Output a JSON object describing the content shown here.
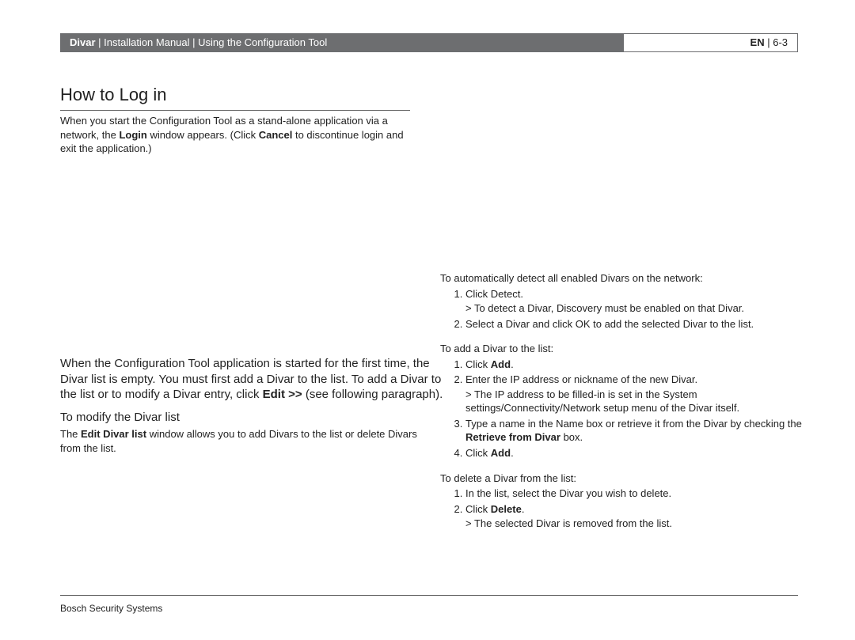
{
  "header": {
    "product": "Divar",
    "trail": " | Installation Manual | Using the Configuration Tool",
    "lang": "EN",
    "page": " | 6-3"
  },
  "heading": "How to Log in",
  "intro": {
    "p1a": "When you start the Configuration Tool as a stand-alone application via a network, the ",
    "login": "Login",
    "p1b": " window appears. (Click ",
    "cancel": "Cancel",
    "p1c": " to discontinue login and exit the application.)"
  },
  "mid": {
    "t1": "When the Configuration Tool application is started for the first time, the Divar list is empty. You must first add a Divar to the list. To add a Divar to the list or to modify a Divar entry, click ",
    "edit": "Edit >>",
    "t2": " (see following paragraph)."
  },
  "sub": {
    "heading": "To modify the Divar list",
    "body_a": "The ",
    "body_b": "Edit Divar list",
    "body_c": " window allows you to add Divars to the list or delete Divars from the list."
  },
  "right": {
    "detect": {
      "lead": "To automatically detect all enabled Divars on the network:",
      "li1": "Click Detect.",
      "li1note": "> To detect a Divar, Discovery must be enabled on that Divar.",
      "li2": "Select a Divar and click OK to add the selected Divar to the list."
    },
    "add": {
      "lead": "To add a Divar to the list:",
      "li1a": "Click ",
      "li1b": "Add",
      "li1c": ".",
      "li2": "Enter the IP address or nickname of the new Divar.",
      "li2note": "> The IP address to be filled-in is set in the System settings/Connectivity/Network setup menu of the Divar itself.",
      "li3a": "Type a name in the Name box or retrieve it from the Divar by checking the ",
      "li3b": "Retrieve from Divar",
      "li3c": " box.",
      "li4a": "Click ",
      "li4b": "Add",
      "li4c": "."
    },
    "del": {
      "lead": "To delete a Divar from the list:",
      "li1": "In the list, select the Divar you wish to delete.",
      "li2a": "Click ",
      "li2b": "Delete",
      "li2c": ".",
      "li2note": "> The selected Divar is removed from the list."
    }
  },
  "footer": "Bosch Security Systems"
}
